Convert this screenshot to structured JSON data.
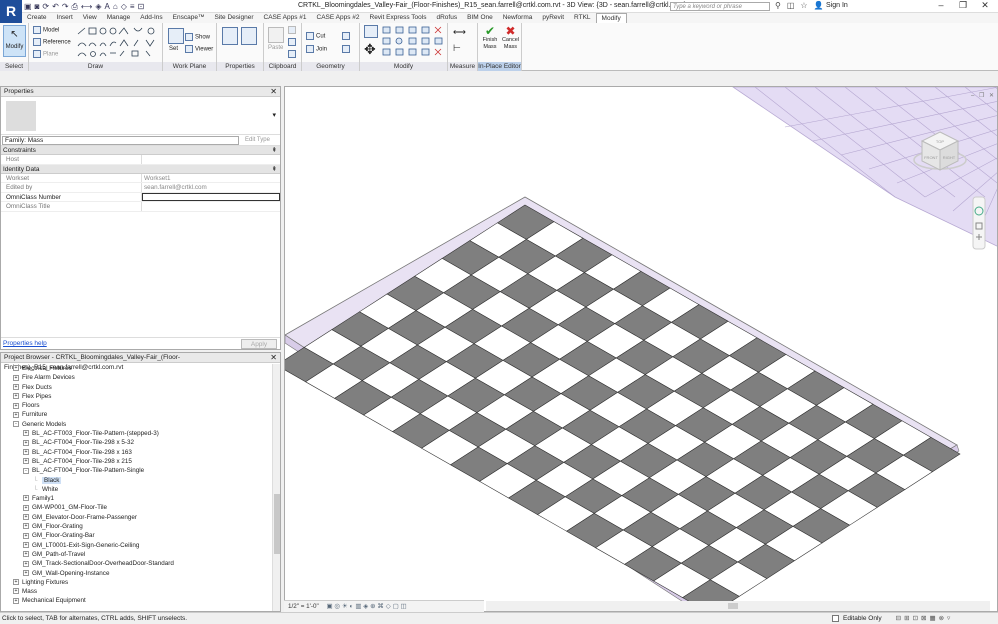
{
  "app": {
    "logo": "R",
    "title": "CRTKL_Bloomingdales_Valley-Fair_(Floor-Finishes)_R15_sean.farrell@crtkl.com.rvt - 3D View: {3D - sean.farrell@crtkl.com}",
    "search_placeholder": "Type a keyword or phrase",
    "sign_in": "Sign In",
    "quick_access_icons": [
      "open-icon",
      "save-icon",
      "sync-icon",
      "undo-icon",
      "redo-icon",
      "print-icon",
      "measure-icon",
      "tag-icon",
      "text-icon",
      "3d-view-icon",
      "section-icon",
      "thin-lines-icon",
      "close-hidden-icon"
    ],
    "window_controls": [
      "minimize",
      "restore",
      "close"
    ]
  },
  "tabs": [
    "Create",
    "Insert",
    "View",
    "Manage",
    "Add-Ins",
    "Enscape™",
    "Site Designer",
    "CASE Apps #1",
    "CASE Apps #2",
    "Revit Express Tools",
    "dRofus",
    "BIM One",
    "Newforma",
    "pyRevit",
    "RTKL",
    "Modify"
  ],
  "active_tab": "Modify",
  "ribbon": {
    "panels": [
      {
        "label": "Select",
        "buttons": [
          "Modify"
        ]
      },
      {
        "label": "Draw",
        "buttons": [
          "Model",
          "Reference",
          "Plane"
        ]
      },
      {
        "label": "Work Plane",
        "buttons": [
          "Set",
          "Show",
          "Viewer"
        ]
      },
      {
        "label": "Properties",
        "buttons": []
      },
      {
        "label": "Clipboard",
        "buttons": [
          "Paste"
        ]
      },
      {
        "label": "Geometry",
        "buttons": [
          "Cut",
          "Join"
        ]
      },
      {
        "label": "Modify",
        "buttons": []
      },
      {
        "label": "Measure",
        "buttons": []
      },
      {
        "label": "In-Place Editor",
        "buttons": [
          "Finish Mass",
          "Cancel Mass"
        ]
      }
    ]
  },
  "properties": {
    "header": "Properties",
    "family_label": "Family: Mass",
    "edit_type": "Edit Type",
    "groups": [
      {
        "name": "Constraints",
        "rows": [
          {
            "key": "Host",
            "value": ""
          }
        ]
      },
      {
        "name": "Identity Data",
        "rows": [
          {
            "key": "Workset",
            "value": "Workset1"
          },
          {
            "key": "Edited by",
            "value": "sean.farrell@crtkl.com"
          },
          {
            "key": "OmniClass Number",
            "value": ""
          },
          {
            "key": "OmniClass Title",
            "value": ""
          }
        ]
      }
    ],
    "help_link": "Properties help",
    "apply": "Apply"
  },
  "project_browser": {
    "header": "Project Browser - CRTKL_Bloomingdales_Valley-Fair_(Floor-Finishes)_R15_sean.farrell@crtkl.com.rvt",
    "items": [
      {
        "label": "Electrical Fixtures",
        "level": 1,
        "toggle": "+"
      },
      {
        "label": "Fire Alarm Devices",
        "level": 1,
        "toggle": "+"
      },
      {
        "label": "Flex Ducts",
        "level": 1,
        "toggle": "+"
      },
      {
        "label": "Flex Pipes",
        "level": 1,
        "toggle": "+"
      },
      {
        "label": "Floors",
        "level": 1,
        "toggle": "+"
      },
      {
        "label": "Furniture",
        "level": 1,
        "toggle": "+"
      },
      {
        "label": "Generic Models",
        "level": 1,
        "toggle": "-"
      },
      {
        "label": "BL_AC-FT003_Floor-Tile-Pattern-(stepped-3)",
        "level": 2,
        "toggle": "+"
      },
      {
        "label": "BL_AC-FT004_Floor-Tile-298 x 5-32",
        "level": 2,
        "toggle": "+"
      },
      {
        "label": "BL_AC-FT004_Floor-Tile-298 x 163",
        "level": 2,
        "toggle": "+"
      },
      {
        "label": "BL_AC-FT004_Floor-Tile-298 x 215",
        "level": 2,
        "toggle": "+"
      },
      {
        "label": "BL_AC-FT004_Floor-Tile-Pattern-Single",
        "level": 2,
        "toggle": "-"
      },
      {
        "label": "Black",
        "level": 3,
        "toggle": "",
        "selected": true
      },
      {
        "label": "White",
        "level": 3,
        "toggle": ""
      },
      {
        "label": "Family1",
        "level": 2,
        "toggle": "+"
      },
      {
        "label": "GM-WP001_GM-Floor-Tile",
        "level": 2,
        "toggle": "+"
      },
      {
        "label": "GM_Elevator-Door-Frame-Passenger",
        "level": 2,
        "toggle": "+"
      },
      {
        "label": "GM_Floor-Grating",
        "level": 2,
        "toggle": "+"
      },
      {
        "label": "GM_Floor-Grating-Bar",
        "level": 2,
        "toggle": "+"
      },
      {
        "label": "GM_LT0001-Exit-Sign-Generic-Ceiling",
        "level": 2,
        "toggle": "+"
      },
      {
        "label": "GM_Path-of-Travel",
        "level": 2,
        "toggle": "+"
      },
      {
        "label": "GM_Track-SectionalDoor-OverheadDoor-Standard",
        "level": 2,
        "toggle": "+"
      },
      {
        "label": "GM_Wall-Opening-Instance",
        "level": 2,
        "toggle": "+"
      },
      {
        "label": "Lighting Fixtures",
        "level": 1,
        "toggle": "+"
      },
      {
        "label": "Mass",
        "level": 1,
        "toggle": "+"
      },
      {
        "label": "Mechanical Equipment",
        "level": 1,
        "toggle": "+"
      }
    ]
  },
  "view": {
    "scale": "1/2\" = 1'-0\"",
    "tile_dark": "#7f7f7f",
    "tile_light": "#ffffff",
    "slab_color": "#e6dcf0",
    "viewcube_labels": [
      "TOP",
      "FRONT",
      "RIGHT"
    ]
  },
  "status": {
    "message": "Click to select, TAB for alternates, CTRL adds, SHIFT unselects.",
    "editable_only": "Editable Only"
  }
}
